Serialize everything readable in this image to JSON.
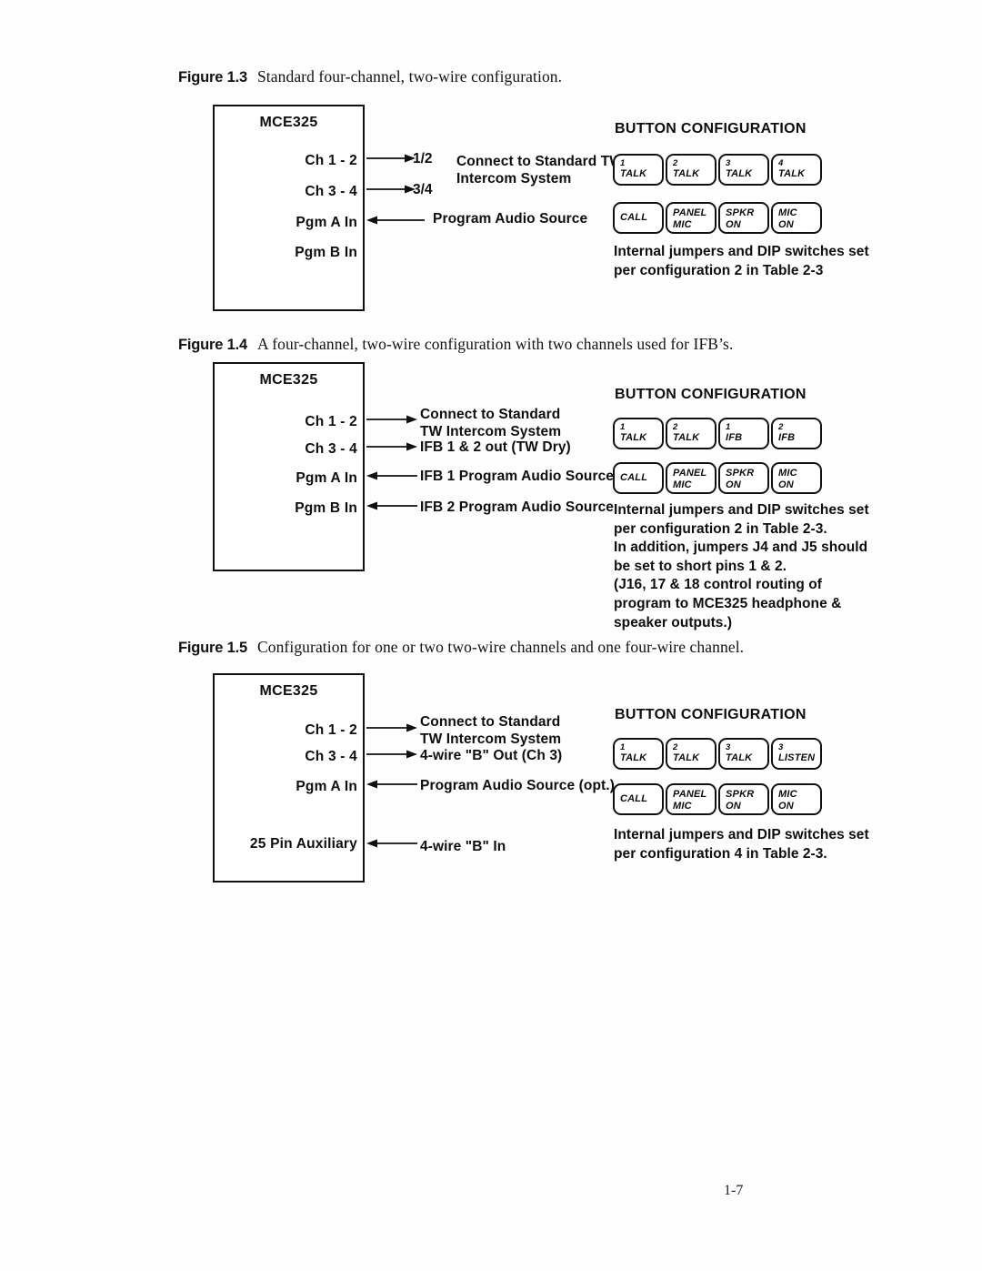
{
  "page": {
    "footer": "1-7"
  },
  "figures": [
    {
      "id": "figure-1-3",
      "label": "Figure 1.3",
      "caption": "Standard four-channel, two-wire configuration.",
      "device": {
        "title": "MCE325",
        "ports": [
          {
            "name": "Ch 1 - 2",
            "arrow": "right",
            "endpoint": "1/2"
          },
          {
            "name": "Ch 3 - 4",
            "arrow": "right",
            "endpoint": "3/4"
          },
          {
            "name": "Pgm A In",
            "arrow": "left",
            "endpoint": ""
          },
          {
            "name": "Pgm B In",
            "arrow": "none",
            "endpoint": ""
          }
        ]
      },
      "descriptions": [
        "Connect to Standard TW",
        "Intercom System",
        "Program Audio Source"
      ],
      "button_config": {
        "title": "BUTTON CONFIGURATION",
        "row1": [
          {
            "num": "1",
            "label": "TALK"
          },
          {
            "num": "2",
            "label": "TALK"
          },
          {
            "num": "3",
            "label": "TALK"
          },
          {
            "num": "4",
            "label": "TALK"
          }
        ],
        "row2": [
          {
            "label": "CALL",
            "label2": ""
          },
          {
            "label": "PANEL",
            "label2": "MIC"
          },
          {
            "label": "SPKR",
            "label2": "ON"
          },
          {
            "label": "MIC",
            "label2": "ON"
          }
        ]
      },
      "note": [
        "Internal jumpers and DIP switches set",
        "per configuration 2 in Table 2-3"
      ]
    },
    {
      "id": "figure-1-4",
      "label": "Figure 1.4",
      "caption": "A four-channel, two-wire configuration with two channels used for IFB’s.",
      "device": {
        "title": "MCE325",
        "ports": [
          {
            "name": "Ch 1 - 2",
            "arrow": "right",
            "endpoint": ""
          },
          {
            "name": "Ch 3 - 4",
            "arrow": "right",
            "endpoint": ""
          },
          {
            "name": "Pgm A In",
            "arrow": "left",
            "endpoint": ""
          },
          {
            "name": "Pgm B In",
            "arrow": "left",
            "endpoint": ""
          }
        ]
      },
      "descriptions": [
        "Connect to Standard",
        "TW Intercom System",
        "IFB 1 & 2 out (TW Dry)",
        "IFB 1 Program Audio Source",
        "IFB 2 Program Audio Source"
      ],
      "button_config": {
        "title": "BUTTON CONFIGURATION",
        "row1": [
          {
            "num": "1",
            "label": "TALK"
          },
          {
            "num": "2",
            "label": "TALK"
          },
          {
            "num": "1",
            "label": "IFB"
          },
          {
            "num": "2",
            "label": "IFB"
          }
        ],
        "row2": [
          {
            "label": "CALL",
            "label2": ""
          },
          {
            "label": "PANEL",
            "label2": "MIC"
          },
          {
            "label": "SPKR",
            "label2": "ON"
          },
          {
            "label": "MIC",
            "label2": "ON"
          }
        ]
      },
      "note": [
        "Internal jumpers and DIP switches set",
        "per configuration 2 in Table 2-3.",
        "In addition, jumpers J4 and J5 should",
        "be set to short pins 1 & 2.",
        "(J16, 17 & 18 control routing of",
        "program to MCE325 headphone &",
        "speaker outputs.)"
      ]
    },
    {
      "id": "figure-1-5",
      "label": "Figure 1.5",
      "caption": "Configuration for one or two two-wire channels and one four-wire channel.",
      "device": {
        "title": "MCE325",
        "ports": [
          {
            "name": "Ch 1 - 2",
            "arrow": "right",
            "endpoint": ""
          },
          {
            "name": "Ch 3 - 4",
            "arrow": "right",
            "endpoint": ""
          },
          {
            "name": "Pgm A In",
            "arrow": "left",
            "endpoint": ""
          },
          {
            "name": "25 Pin Auxiliary",
            "arrow": "left",
            "endpoint": ""
          }
        ]
      },
      "descriptions": [
        "Connect to Standard",
        "TW Intercom System",
        "4-wire \"B\" Out (Ch 3)",
        "Program Audio Source (opt.)",
        "4-wire \"B\" In"
      ],
      "button_config": {
        "title": "BUTTON CONFIGURATION",
        "row1": [
          {
            "num": "1",
            "label": "TALK"
          },
          {
            "num": "2",
            "label": "TALK"
          },
          {
            "num": "3",
            "label": "TALK"
          },
          {
            "num": "3",
            "label": "LISTEN"
          }
        ],
        "row2": [
          {
            "label": "CALL",
            "label2": ""
          },
          {
            "label": "PANEL",
            "label2": "MIC"
          },
          {
            "label": "SPKR",
            "label2": "ON"
          },
          {
            "label": "MIC",
            "label2": "ON"
          }
        ]
      },
      "note": [
        "Internal jumpers and DIP switches set",
        "per configuration 4 in Table 2-3."
      ]
    }
  ]
}
